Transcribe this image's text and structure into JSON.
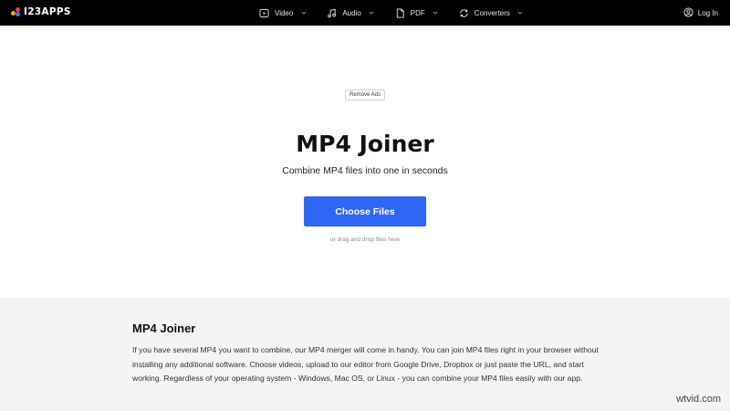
{
  "header": {
    "logo_text": "I23APPS",
    "nav": [
      {
        "label": "Video",
        "icon": "video-icon"
      },
      {
        "label": "Audio",
        "icon": "music-note-icon"
      },
      {
        "label": "PDF",
        "icon": "document-icon"
      },
      {
        "label": "Converters",
        "icon": "convert-icon"
      }
    ],
    "login_label": "Log In"
  },
  "hero": {
    "remove_ads_label": "Remove Ads",
    "title": "MP4 Joiner",
    "subtitle": "Combine MP4 files into one in seconds",
    "choose_files_label": "Choose Files",
    "drag_hint": "or drag and drop files here"
  },
  "info": {
    "title": "MP4 Joiner",
    "paragraph": "If you have several MP4 you want to combine, our MP4 merger will come in handy. You can join MP4 files right in your browser without installing any additional software. Choose videos, upload to our editor from Google Drive, Dropbox or just paste the URL, and start working. Regardless of your operating system - Windows, Mac OS, or Linux - you can combine your MP4 files easily with our app."
  },
  "watermark": "wtvid.com",
  "colors": {
    "topbar": "#000000",
    "primary_button": "#2f66f6",
    "info_background": "#f3f4f6"
  }
}
